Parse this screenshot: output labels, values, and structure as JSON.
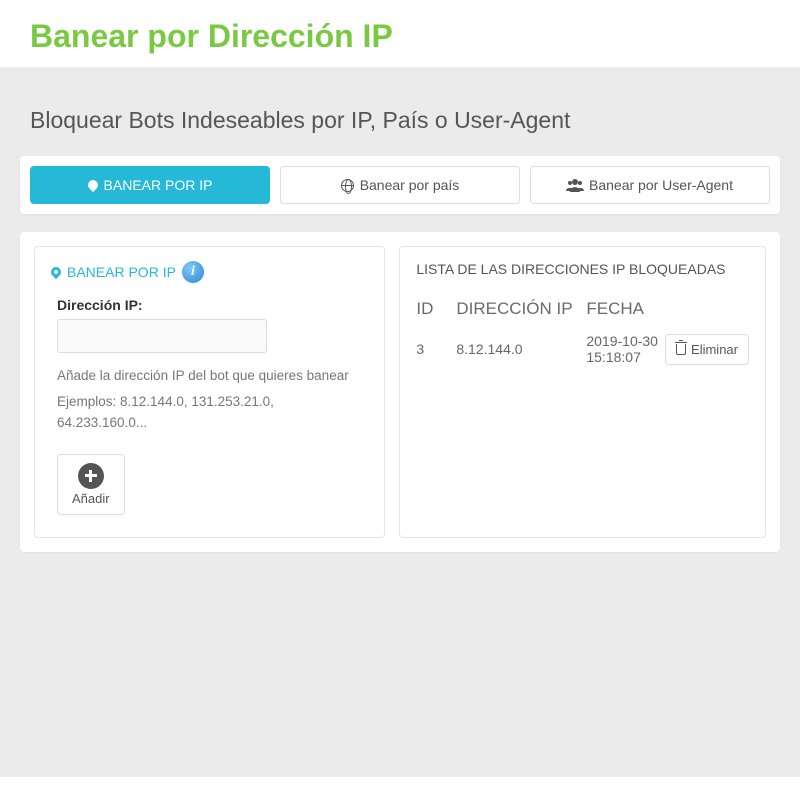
{
  "main_title": "Banear por Dirección IP",
  "subtitle": "Bloquear Bots Indeseables por IP, País o User-Agent",
  "tabs": [
    {
      "label": "BANEAR POR IP",
      "active": true
    },
    {
      "label": "Banear por país",
      "active": false
    },
    {
      "label": "Banear por User-Agent",
      "active": false
    }
  ],
  "left_panel": {
    "header": "BANEAR POR IP",
    "field_label": "Dirección IP:",
    "input_value": "",
    "help1": "Añade la dirección IP del bot que quieres banear",
    "help2": "Ejemplos: 8.12.144.0, 131.253.21.0, 64.233.160.0...",
    "add_label": "Añadir"
  },
  "right_panel": {
    "title": "LISTA DE LAS DIRECCIONES IP BLOQUEADAS",
    "headers": {
      "id": "ID",
      "ip": "DIRECCIÓN IP",
      "date": "FECHA"
    },
    "rows": [
      {
        "id": "3",
        "ip": "8.12.144.0",
        "date": "2019-10-30 15:18:07",
        "delete_label": "Eliminar"
      }
    ]
  }
}
